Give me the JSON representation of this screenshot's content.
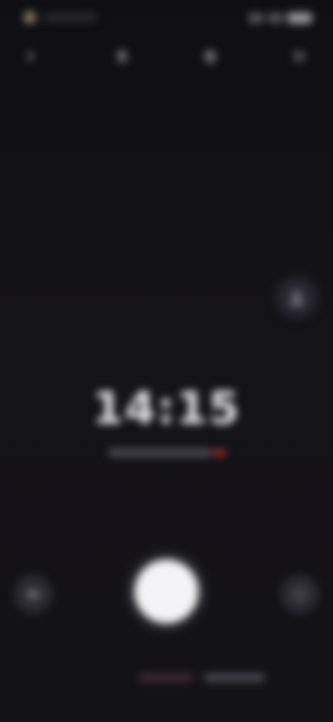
{
  "status_bar": {
    "left_icon": "location-dot-icon",
    "right_icons": [
      "signal-icon",
      "wifi-icon",
      "battery-icon"
    ]
  },
  "top_controls": [
    {
      "name": "flash-toggle",
      "icon": "flash-icon"
    },
    {
      "name": "aspect-ratio",
      "icon": "aspect-icon"
    },
    {
      "name": "timer-setting",
      "icon": "timer-icon"
    },
    {
      "name": "settings",
      "icon": "gear-icon"
    }
  ],
  "timer": {
    "value": "14:15"
  },
  "side_button": {
    "icon": "person-icon"
  },
  "bottom": {
    "left_icon": "gallery-icon",
    "right_icon": "switch-camera-icon"
  },
  "modes": [],
  "colors": {
    "background": "#121116",
    "accent_red": "#c0392b",
    "shutter": "#f4f4f6"
  }
}
